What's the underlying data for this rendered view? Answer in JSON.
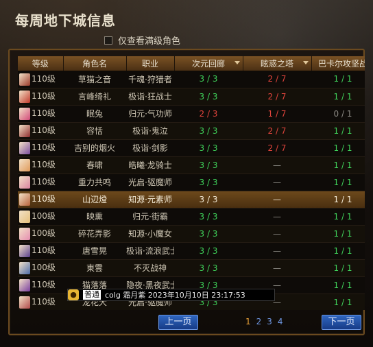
{
  "header": {
    "title": "每周地下城信息"
  },
  "filter": {
    "label": "仅查看满级角色"
  },
  "table": {
    "headers": [
      "等级",
      "角色名",
      "职业",
      "次元回廊",
      "眩惑之塔",
      "巴卡尔攻坚战"
    ],
    "rows": [
      {
        "level": "110级",
        "name": "草猫之音",
        "job": "千魂·狩猎者",
        "a": "3 / 3",
        "b": "2 / 7",
        "c": "1 / 1",
        "av": "#9b3a2a"
      },
      {
        "level": "110级",
        "name": "言峰绮礼",
        "job": "极诣·狂战士",
        "a": "3 / 3",
        "b": "2 / 7",
        "c": "1 / 1",
        "av": "#c0392b"
      },
      {
        "level": "110级",
        "name": "眠兔",
        "job": "归元·气功师",
        "a": "2 / 3",
        "b": "1 / 7",
        "c": "0 / 1",
        "av": "#d24a7a"
      },
      {
        "level": "110级",
        "name": "容恬",
        "job": "极诣·鬼泣",
        "a": "3 / 3",
        "b": "2 / 7",
        "c": "1 / 1",
        "av": "#8e2c2c"
      },
      {
        "level": "110级",
        "name": "吉别的烟火",
        "job": "极诣·剑影",
        "a": "3 / 3",
        "b": "2 / 7",
        "c": "1 / 1",
        "av": "#7a4c9e"
      },
      {
        "level": "110级",
        "name": "春啸",
        "job": "皓曦·龙骑士",
        "a": "3 / 3",
        "b": "—",
        "c": "1 / 1",
        "av": "#e09a5a"
      },
      {
        "level": "110级",
        "name": "重力共鸣",
        "job": "光启·驱魔师",
        "a": "3 / 3",
        "b": "—",
        "c": "1 / 1",
        "av": "#d9829f"
      },
      {
        "level": "110级",
        "name": "山辺燈",
        "job": "知源·元素师",
        "a": "3 / 3",
        "b": "—",
        "c": "1 / 1",
        "av": "#b8613a"
      },
      {
        "level": "100级",
        "name": "映熏",
        "job": "归元·街霸",
        "a": "3 / 3",
        "b": "—",
        "c": "1 / 1",
        "av": "#e6c07a"
      },
      {
        "level": "100级",
        "name": "碎花弄影",
        "job": "知源·小魔女",
        "a": "3 / 3",
        "b": "—",
        "c": "1 / 1",
        "av": "#e58db0"
      },
      {
        "level": "110级",
        "name": "唐雪晃",
        "job": "极诣·流浪武士",
        "a": "3 / 3",
        "b": "—",
        "c": "1 / 1",
        "av": "#5a3f8c"
      },
      {
        "level": "100级",
        "name": "東雲",
        "job": "不灭战神",
        "a": "3 / 3",
        "b": "—",
        "c": "1 / 1",
        "av": "#4a6aa8"
      },
      {
        "level": "110级",
        "name": "猫落落",
        "job": "隐夜·黑夜武士",
        "a": "3 / 3",
        "b": "—",
        "c": "1 / 1",
        "av": "#7a3fa0"
      },
      {
        "level": "110级",
        "name": "龙花大",
        "job": "光启·驱魔师",
        "a": "3 / 3",
        "b": "—",
        "c": "1 / 1",
        "av": "#b04a4a"
      }
    ]
  },
  "pagination": {
    "prev": "上一页",
    "next": "下一页",
    "pages": [
      "1",
      "2",
      "3",
      "4"
    ],
    "current": "1"
  },
  "chat": {
    "tag": "普通",
    "text": "colg    霜月紫    2023年10月10日 23:17:53"
  }
}
